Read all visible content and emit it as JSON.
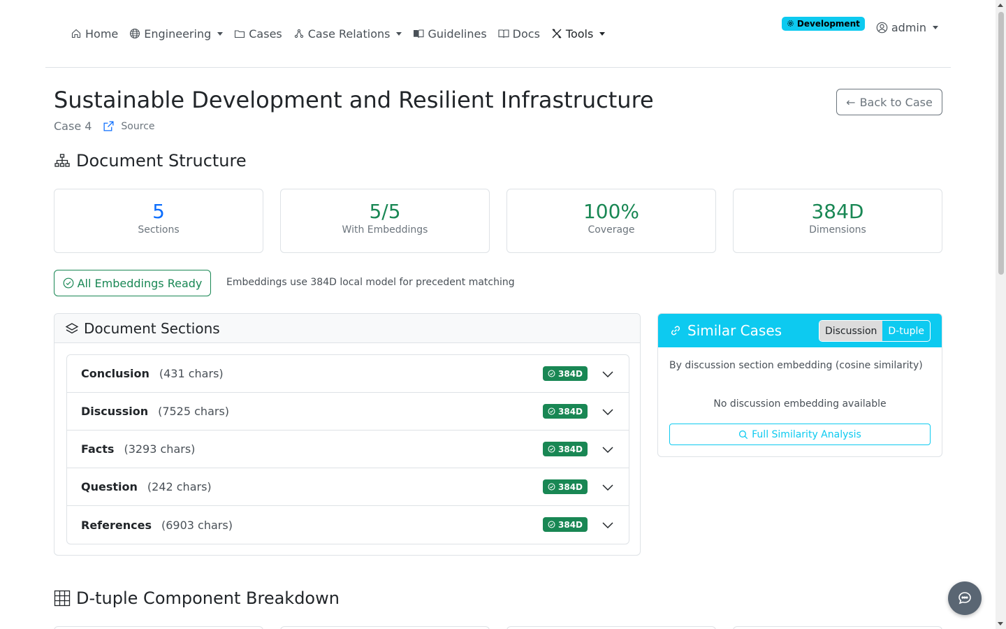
{
  "nav": {
    "home": "Home",
    "engineering": "Engineering",
    "cases": "Cases",
    "case_relations": "Case Relations",
    "guidelines": "Guidelines",
    "docs": "Docs",
    "tools": "Tools",
    "env_badge": "Development",
    "user": "admin"
  },
  "header": {
    "title": "Sustainable Development and Resilient Infrastructure",
    "case_label": "Case 4",
    "source_label": "Source",
    "back_label": "Back to Case"
  },
  "doc_structure": {
    "heading": "Document Structure",
    "stats": [
      {
        "value": "5",
        "label": "Sections",
        "color": "#0d6efd"
      },
      {
        "value": "5/5",
        "label": "With Embeddings",
        "color": "#198754"
      },
      {
        "value": "100%",
        "label": "Coverage",
        "color": "#198754"
      },
      {
        "value": "384D",
        "label": "Dimensions",
        "color": "#198754"
      }
    ],
    "ready_label": "All Embeddings Ready",
    "ready_note": "Embeddings use 384D local model for precedent matching"
  },
  "doc_sections": {
    "heading": "Document Sections",
    "items": [
      {
        "title": "Conclusion",
        "chars": "(431 chars)",
        "badge": "384D"
      },
      {
        "title": "Discussion",
        "chars": "(7525 chars)",
        "badge": "384D"
      },
      {
        "title": "Facts",
        "chars": "(3293 chars)",
        "badge": "384D"
      },
      {
        "title": "Question",
        "chars": "(242 chars)",
        "badge": "384D"
      },
      {
        "title": "References",
        "chars": "(6903 chars)",
        "badge": "384D"
      }
    ]
  },
  "similar": {
    "heading": "Similar Cases",
    "toggle_discussion": "Discussion",
    "toggle_dtuple": "D-tuple",
    "subtitle": "By discussion section embedding (cosine similarity)",
    "empty": "No discussion embedding available",
    "button": "Full Similarity Analysis"
  },
  "dtuple": {
    "heading": "D-tuple Component Breakdown"
  },
  "colors": {
    "primary": "#0d6efd",
    "success": "#198754",
    "info": "#0dcaf0",
    "secondary": "#6c757d"
  }
}
